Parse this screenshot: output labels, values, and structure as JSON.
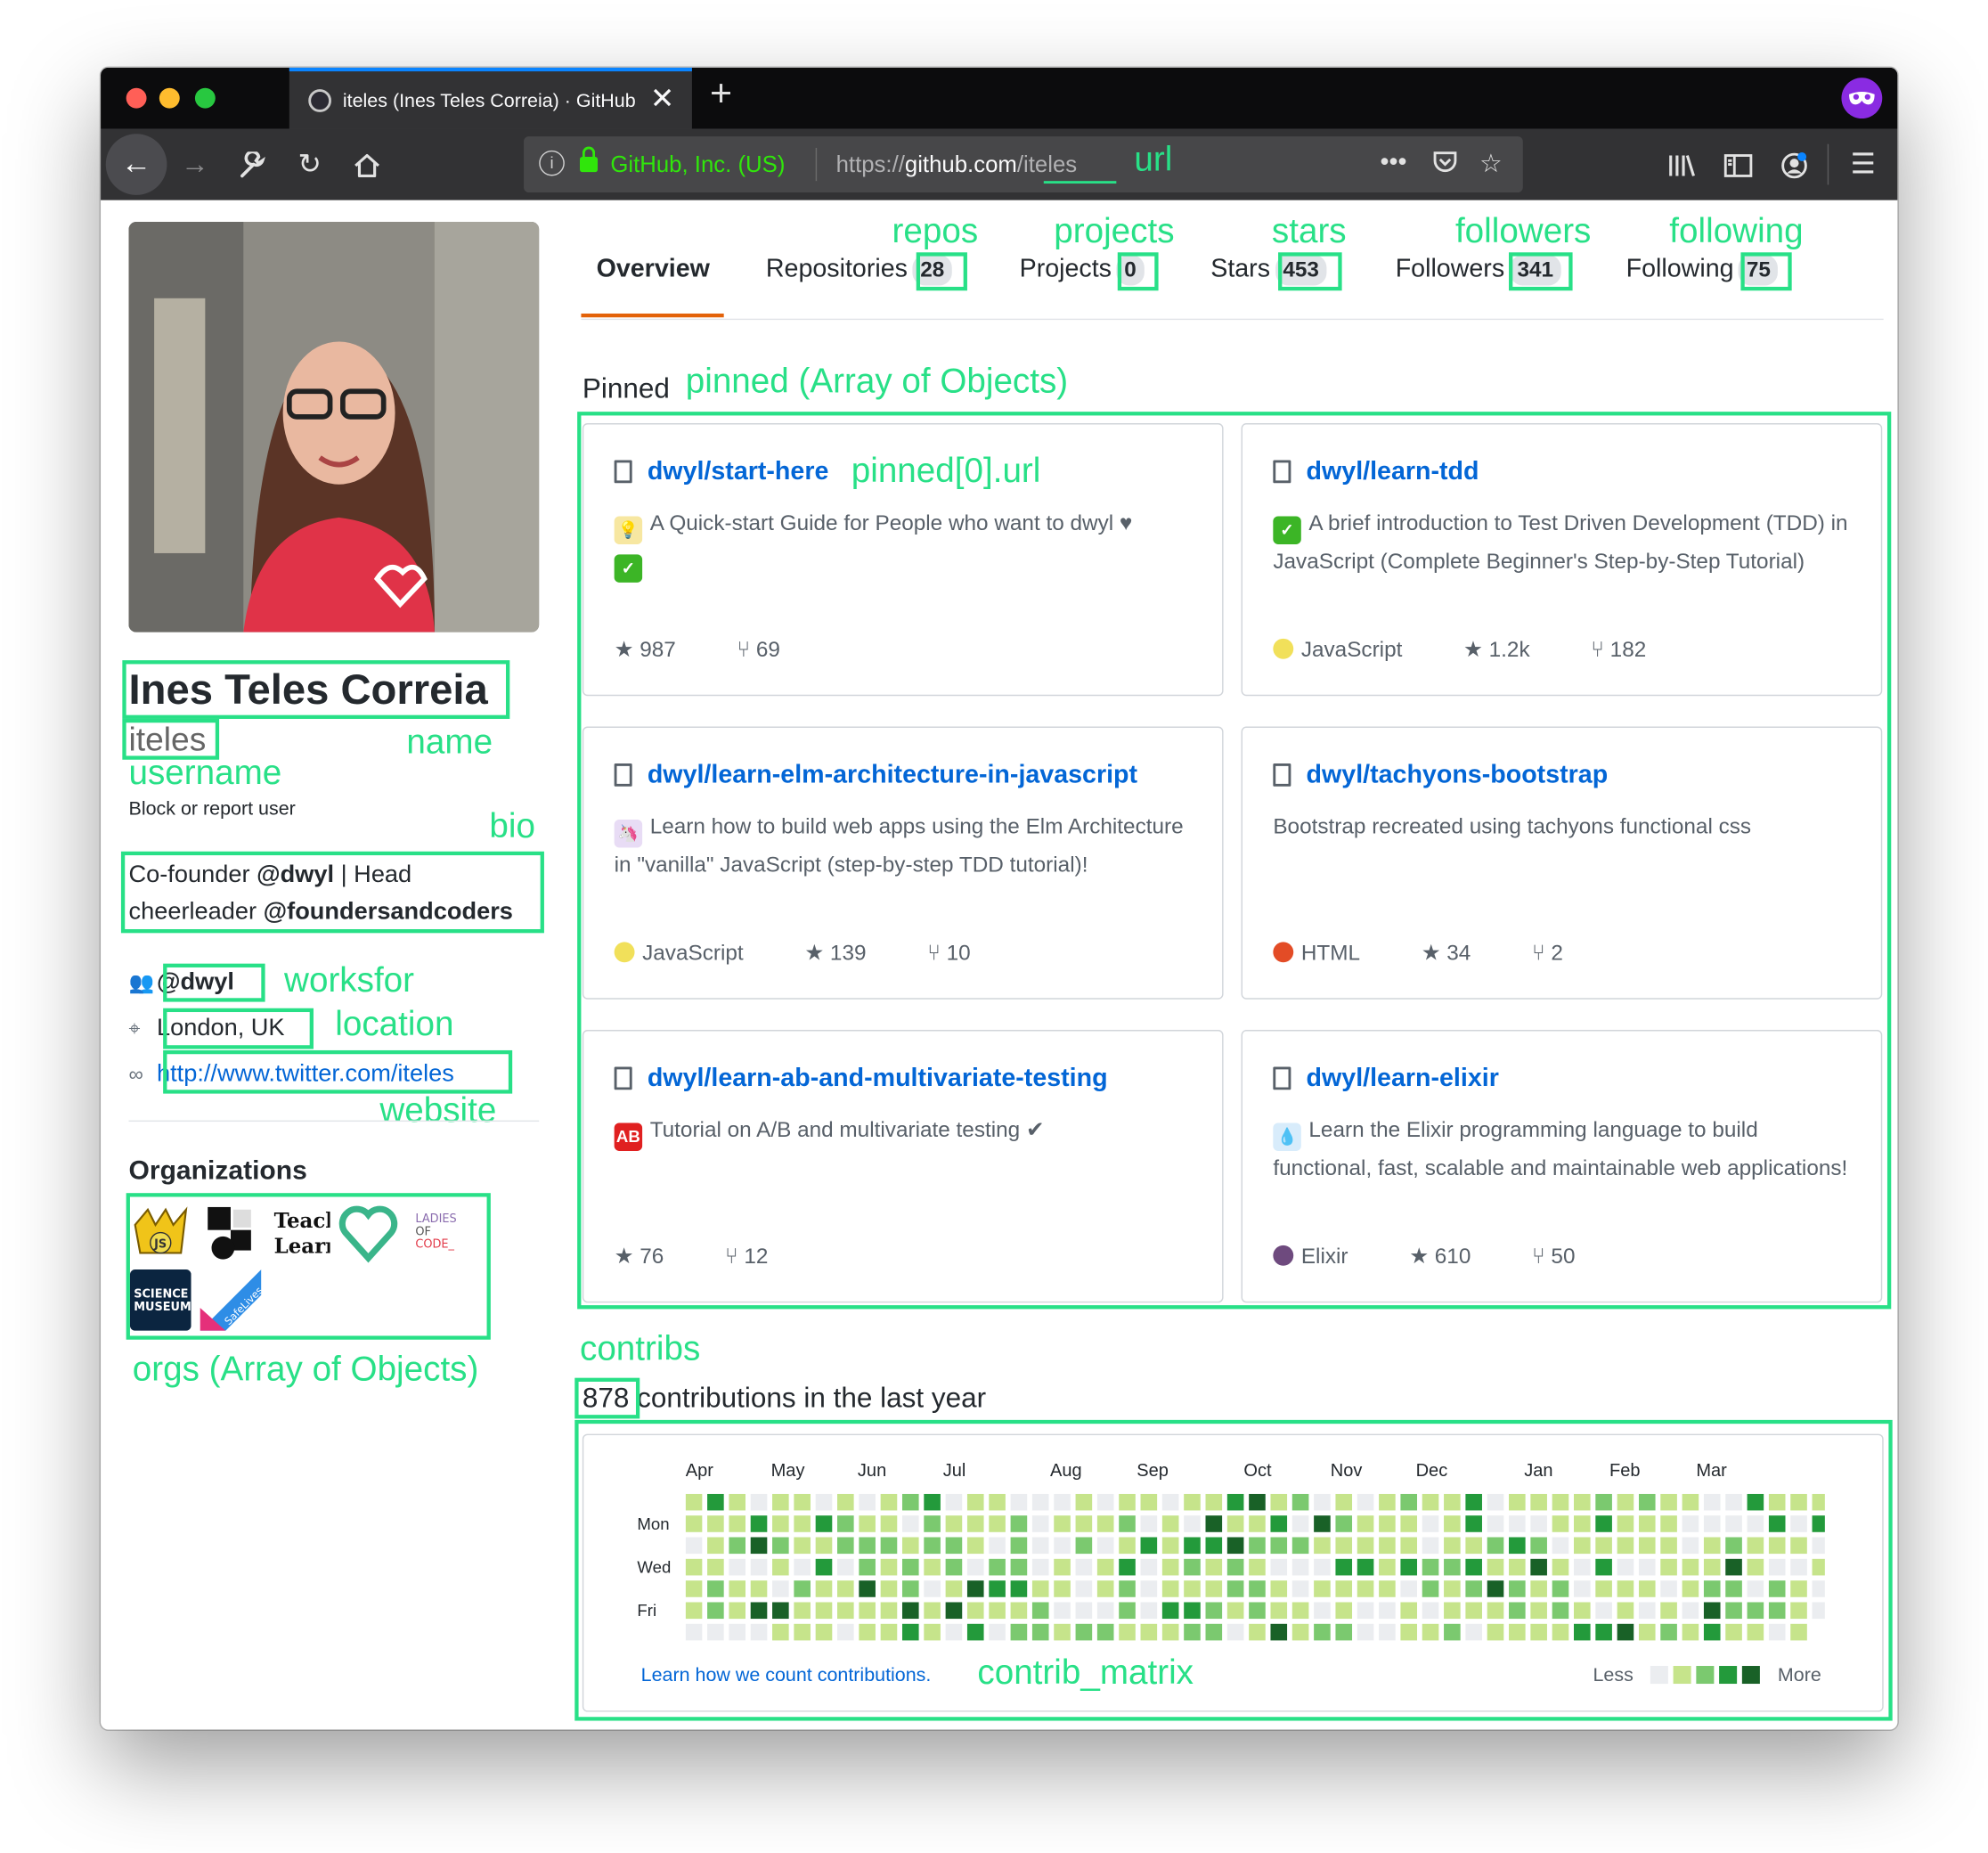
{
  "browser": {
    "tab_title": "iteles (Ines Teles Correia) · GitHub",
    "url_org": "GitHub, Inc. (US)",
    "url_scheme": "https://",
    "url_host": "github.com",
    "url_path": "/iteles"
  },
  "annotations": {
    "url": "url",
    "repos": "repos",
    "projects": "projects",
    "stars": "stars",
    "followers": "followers",
    "following": "following",
    "pinned": "pinned (Array of Objects)",
    "pinned_url": "pinned[0].url",
    "name": "name",
    "username": "username",
    "bio": "bio",
    "worksfor": "worksfor",
    "location": "location",
    "website": "website",
    "orgs": "orgs (Array of Objects)",
    "contribs": "contribs",
    "contrib_matrix": "contrib_matrix"
  },
  "profile": {
    "name": "Ines Teles Correia",
    "username": "iteles",
    "block": "Block or report user",
    "bio_1": "Co-founder ",
    "bio_handle1": "@dwyl",
    "bio_2": " | Head",
    "bio_3": "cheerleader ",
    "bio_handle2": "@foundersandcoders",
    "worksfor": "@dwyl",
    "location": "London, UK",
    "website": "http://www.twitter.com/iteles",
    "organizations_heading": "Organizations",
    "orgs": [
      {
        "name": "JS",
        "color": "#f0c419"
      },
      {
        "name": "BW",
        "color": "#111111"
      },
      {
        "name": "Teach Learn",
        "color": "#ffffff"
      },
      {
        "name": "dwyl",
        "color": "#3ab58a"
      },
      {
        "name": "LADIES OF CODE_",
        "color": "#ffffff"
      },
      {
        "name": "SCIENCE MUSEUM",
        "color": "#0b2540"
      },
      {
        "name": "SafeLives",
        "color": "#e5307a"
      }
    ]
  },
  "nav": {
    "overview": "Overview",
    "repositories": "Repositories",
    "repositories_count": "28",
    "projects": "Projects",
    "projects_count": "0",
    "stars": "Stars",
    "stars_count": "453",
    "followers": "Followers",
    "followers_count": "341",
    "following": "Following",
    "following_count": "75"
  },
  "pinned_heading": "Pinned",
  "pinned": [
    {
      "title": "dwyl/start-here",
      "desc": "A Quick-start Guide for People who want to dwyl ♥",
      "desc2": "✓",
      "lang": "",
      "lang_color": "",
      "stars": "987",
      "forks": "69"
    },
    {
      "title": "dwyl/learn-tdd",
      "desc": "A brief introduction to Test Driven Development (TDD) in JavaScript (Complete Beginner's Step-by-Step Tutorial)",
      "lang": "JavaScript",
      "lang_color": "#f1e05a",
      "stars": "1.2k",
      "forks": "182"
    },
    {
      "title": "dwyl/learn-elm-architecture-in-javascript",
      "desc": "Learn how to build web apps using the Elm Architecture in \"vanilla\" JavaScript (step-by-step TDD tutorial)!",
      "lang": "JavaScript",
      "lang_color": "#f1e05a",
      "stars": "139",
      "forks": "10"
    },
    {
      "title": "dwyl/tachyons-bootstrap",
      "desc": "Bootstrap recreated using tachyons functional css",
      "lang": "HTML",
      "lang_color": "#e34c26",
      "stars": "34",
      "forks": "2"
    },
    {
      "title": "dwyl/learn-ab-and-multivariate-testing",
      "desc": "Tutorial on A/B and multivariate testing ✔",
      "lang": "",
      "lang_color": "",
      "stars": "76",
      "forks": "12"
    },
    {
      "title": "dwyl/learn-elixir",
      "desc": "Learn the Elixir programming language to build functional, fast, scalable and maintainable web applications!",
      "lang": "Elixir",
      "lang_color": "#6e4a7e",
      "stars": "610",
      "forks": "50"
    }
  ],
  "contributions": {
    "count": "878",
    "label": " contributions in the last year",
    "months": [
      "Apr",
      "May",
      "Jun",
      "Jul",
      "Aug",
      "Sep",
      "Oct",
      "Nov",
      "Dec",
      "Jan",
      "Feb",
      "Mar"
    ],
    "days": [
      "Mon",
      "Wed",
      "Fri"
    ],
    "learn": "Learn how we count contributions.",
    "less": "Less",
    "more": "More",
    "colors": [
      "#ebedf0",
      "#c6e48b",
      "#7bc96f",
      "#239a3b",
      "#196127"
    ]
  }
}
